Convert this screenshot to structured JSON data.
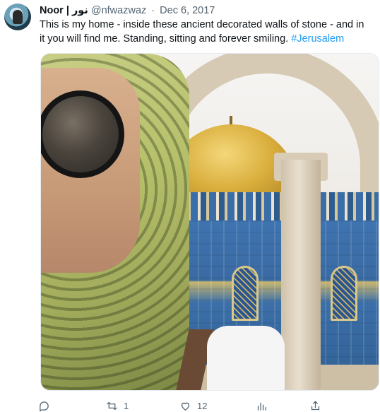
{
  "tweet": {
    "author_name": "Noor | نور",
    "handle": "@nfwazwaz",
    "separator": "·",
    "date": "Dec 6, 2017",
    "text": "This is my home - inside these ancient decorated walls of stone - and in it you will find me. Standing, sitting and forever smiling. ",
    "hashtag": "#Jerusalem"
  },
  "actions": {
    "replies": "",
    "retweets": "1",
    "likes": "12",
    "views": ""
  },
  "icons": {
    "reply": "reply-icon",
    "retweet": "retweet-icon",
    "like": "heart-icon",
    "views": "bar-chart-icon",
    "share": "share-icon"
  },
  "colors": {
    "hashtag": "#1d9bf0",
    "muted": "#536471",
    "text": "#0f1419"
  }
}
